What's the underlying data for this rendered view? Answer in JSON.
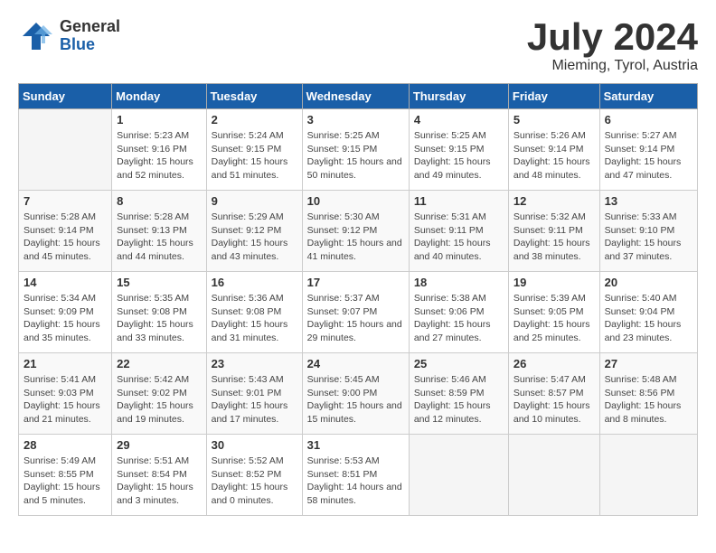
{
  "header": {
    "logo_general": "General",
    "logo_blue": "Blue",
    "month_title": "July 2024",
    "location": "Mieming, Tyrol, Austria"
  },
  "days_of_week": [
    "Sunday",
    "Monday",
    "Tuesday",
    "Wednesday",
    "Thursday",
    "Friday",
    "Saturday"
  ],
  "weeks": [
    [
      {
        "day": "",
        "sunrise": "",
        "sunset": "",
        "daylight": ""
      },
      {
        "day": "1",
        "sunrise": "Sunrise: 5:23 AM",
        "sunset": "Sunset: 9:16 PM",
        "daylight": "Daylight: 15 hours and 52 minutes."
      },
      {
        "day": "2",
        "sunrise": "Sunrise: 5:24 AM",
        "sunset": "Sunset: 9:15 PM",
        "daylight": "Daylight: 15 hours and 51 minutes."
      },
      {
        "day": "3",
        "sunrise": "Sunrise: 5:25 AM",
        "sunset": "Sunset: 9:15 PM",
        "daylight": "Daylight: 15 hours and 50 minutes."
      },
      {
        "day": "4",
        "sunrise": "Sunrise: 5:25 AM",
        "sunset": "Sunset: 9:15 PM",
        "daylight": "Daylight: 15 hours and 49 minutes."
      },
      {
        "day": "5",
        "sunrise": "Sunrise: 5:26 AM",
        "sunset": "Sunset: 9:14 PM",
        "daylight": "Daylight: 15 hours and 48 minutes."
      },
      {
        "day": "6",
        "sunrise": "Sunrise: 5:27 AM",
        "sunset": "Sunset: 9:14 PM",
        "daylight": "Daylight: 15 hours and 47 minutes."
      }
    ],
    [
      {
        "day": "7",
        "sunrise": "Sunrise: 5:28 AM",
        "sunset": "Sunset: 9:14 PM",
        "daylight": "Daylight: 15 hours and 45 minutes."
      },
      {
        "day": "8",
        "sunrise": "Sunrise: 5:28 AM",
        "sunset": "Sunset: 9:13 PM",
        "daylight": "Daylight: 15 hours and 44 minutes."
      },
      {
        "day": "9",
        "sunrise": "Sunrise: 5:29 AM",
        "sunset": "Sunset: 9:12 PM",
        "daylight": "Daylight: 15 hours and 43 minutes."
      },
      {
        "day": "10",
        "sunrise": "Sunrise: 5:30 AM",
        "sunset": "Sunset: 9:12 PM",
        "daylight": "Daylight: 15 hours and 41 minutes."
      },
      {
        "day": "11",
        "sunrise": "Sunrise: 5:31 AM",
        "sunset": "Sunset: 9:11 PM",
        "daylight": "Daylight: 15 hours and 40 minutes."
      },
      {
        "day": "12",
        "sunrise": "Sunrise: 5:32 AM",
        "sunset": "Sunset: 9:11 PM",
        "daylight": "Daylight: 15 hours and 38 minutes."
      },
      {
        "day": "13",
        "sunrise": "Sunrise: 5:33 AM",
        "sunset": "Sunset: 9:10 PM",
        "daylight": "Daylight: 15 hours and 37 minutes."
      }
    ],
    [
      {
        "day": "14",
        "sunrise": "Sunrise: 5:34 AM",
        "sunset": "Sunset: 9:09 PM",
        "daylight": "Daylight: 15 hours and 35 minutes."
      },
      {
        "day": "15",
        "sunrise": "Sunrise: 5:35 AM",
        "sunset": "Sunset: 9:08 PM",
        "daylight": "Daylight: 15 hours and 33 minutes."
      },
      {
        "day": "16",
        "sunrise": "Sunrise: 5:36 AM",
        "sunset": "Sunset: 9:08 PM",
        "daylight": "Daylight: 15 hours and 31 minutes."
      },
      {
        "day": "17",
        "sunrise": "Sunrise: 5:37 AM",
        "sunset": "Sunset: 9:07 PM",
        "daylight": "Daylight: 15 hours and 29 minutes."
      },
      {
        "day": "18",
        "sunrise": "Sunrise: 5:38 AM",
        "sunset": "Sunset: 9:06 PM",
        "daylight": "Daylight: 15 hours and 27 minutes."
      },
      {
        "day": "19",
        "sunrise": "Sunrise: 5:39 AM",
        "sunset": "Sunset: 9:05 PM",
        "daylight": "Daylight: 15 hours and 25 minutes."
      },
      {
        "day": "20",
        "sunrise": "Sunrise: 5:40 AM",
        "sunset": "Sunset: 9:04 PM",
        "daylight": "Daylight: 15 hours and 23 minutes."
      }
    ],
    [
      {
        "day": "21",
        "sunrise": "Sunrise: 5:41 AM",
        "sunset": "Sunset: 9:03 PM",
        "daylight": "Daylight: 15 hours and 21 minutes."
      },
      {
        "day": "22",
        "sunrise": "Sunrise: 5:42 AM",
        "sunset": "Sunset: 9:02 PM",
        "daylight": "Daylight: 15 hours and 19 minutes."
      },
      {
        "day": "23",
        "sunrise": "Sunrise: 5:43 AM",
        "sunset": "Sunset: 9:01 PM",
        "daylight": "Daylight: 15 hours and 17 minutes."
      },
      {
        "day": "24",
        "sunrise": "Sunrise: 5:45 AM",
        "sunset": "Sunset: 9:00 PM",
        "daylight": "Daylight: 15 hours and 15 minutes."
      },
      {
        "day": "25",
        "sunrise": "Sunrise: 5:46 AM",
        "sunset": "Sunset: 8:59 PM",
        "daylight": "Daylight: 15 hours and 12 minutes."
      },
      {
        "day": "26",
        "sunrise": "Sunrise: 5:47 AM",
        "sunset": "Sunset: 8:57 PM",
        "daylight": "Daylight: 15 hours and 10 minutes."
      },
      {
        "day": "27",
        "sunrise": "Sunrise: 5:48 AM",
        "sunset": "Sunset: 8:56 PM",
        "daylight": "Daylight: 15 hours and 8 minutes."
      }
    ],
    [
      {
        "day": "28",
        "sunrise": "Sunrise: 5:49 AM",
        "sunset": "Sunset: 8:55 PM",
        "daylight": "Daylight: 15 hours and 5 minutes."
      },
      {
        "day": "29",
        "sunrise": "Sunrise: 5:51 AM",
        "sunset": "Sunset: 8:54 PM",
        "daylight": "Daylight: 15 hours and 3 minutes."
      },
      {
        "day": "30",
        "sunrise": "Sunrise: 5:52 AM",
        "sunset": "Sunset: 8:52 PM",
        "daylight": "Daylight: 15 hours and 0 minutes."
      },
      {
        "day": "31",
        "sunrise": "Sunrise: 5:53 AM",
        "sunset": "Sunset: 8:51 PM",
        "daylight": "Daylight: 14 hours and 58 minutes."
      },
      {
        "day": "",
        "sunrise": "",
        "sunset": "",
        "daylight": ""
      },
      {
        "day": "",
        "sunrise": "",
        "sunset": "",
        "daylight": ""
      },
      {
        "day": "",
        "sunrise": "",
        "sunset": "",
        "daylight": ""
      }
    ]
  ]
}
